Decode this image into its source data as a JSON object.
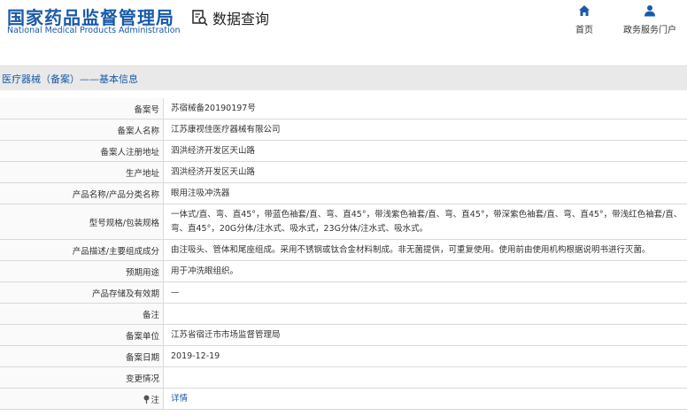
{
  "header": {
    "logo_cn": "国家药品监督管理局",
    "logo_en": "National Medical Products Administration",
    "query_label": "数据查询",
    "nav": [
      {
        "icon": "home-icon",
        "label": "首页"
      },
      {
        "icon": "user-icon",
        "label": "政务服务门户"
      }
    ]
  },
  "section": {
    "title": "医疗器械（备案）——基本信息"
  },
  "colors": {
    "brand_blue": "#1a5aa8",
    "section_bg": "#e9e9e9"
  },
  "rows": [
    {
      "label": "备案号",
      "value": "苏宿械备20190197号"
    },
    {
      "label": "备案人名称",
      "value": "江苏康视佳医疗器械有限公司"
    },
    {
      "label": "备案人注册地址",
      "value": "泗洪经济开发区天山路"
    },
    {
      "label": "生产地址",
      "value": "泗洪经济开发区天山路"
    },
    {
      "label": "产品名称/产品分类名称",
      "value": "眼用注吸冲洗器"
    },
    {
      "label": "型号规格/包装规格",
      "value": "一体式/直、弯、直45°，带蓝色袖套/直、弯、直45°，带浅紫色袖套/直、弯、直45°，带深紫色袖套/直、弯、直45°，带浅红色袖套/直、弯、直45°，20G分体/注水式、吸水式，23G分体/注水式、吸水式。"
    },
    {
      "label": "产品描述/主要组成成分",
      "value": "由注吸头、管体和尾座组成。采用不锈钢或钛合金材料制成。非无菌提供，可重复使用。使用前由使用机构根据说明书进行灭菌。"
    },
    {
      "label": "预期用途",
      "value": "用于冲洗眼组织。"
    },
    {
      "label": "产品存储及有效期",
      "value": "—"
    },
    {
      "label": "备注",
      "value": ""
    },
    {
      "label": "备案单位",
      "value": "江苏省宿迁市市场监督管理局"
    },
    {
      "label": "备案日期",
      "value": "2019-12-19"
    },
    {
      "label": "变更情况",
      "value": ""
    },
    {
      "label": "注",
      "value": "详情"
    }
  ]
}
